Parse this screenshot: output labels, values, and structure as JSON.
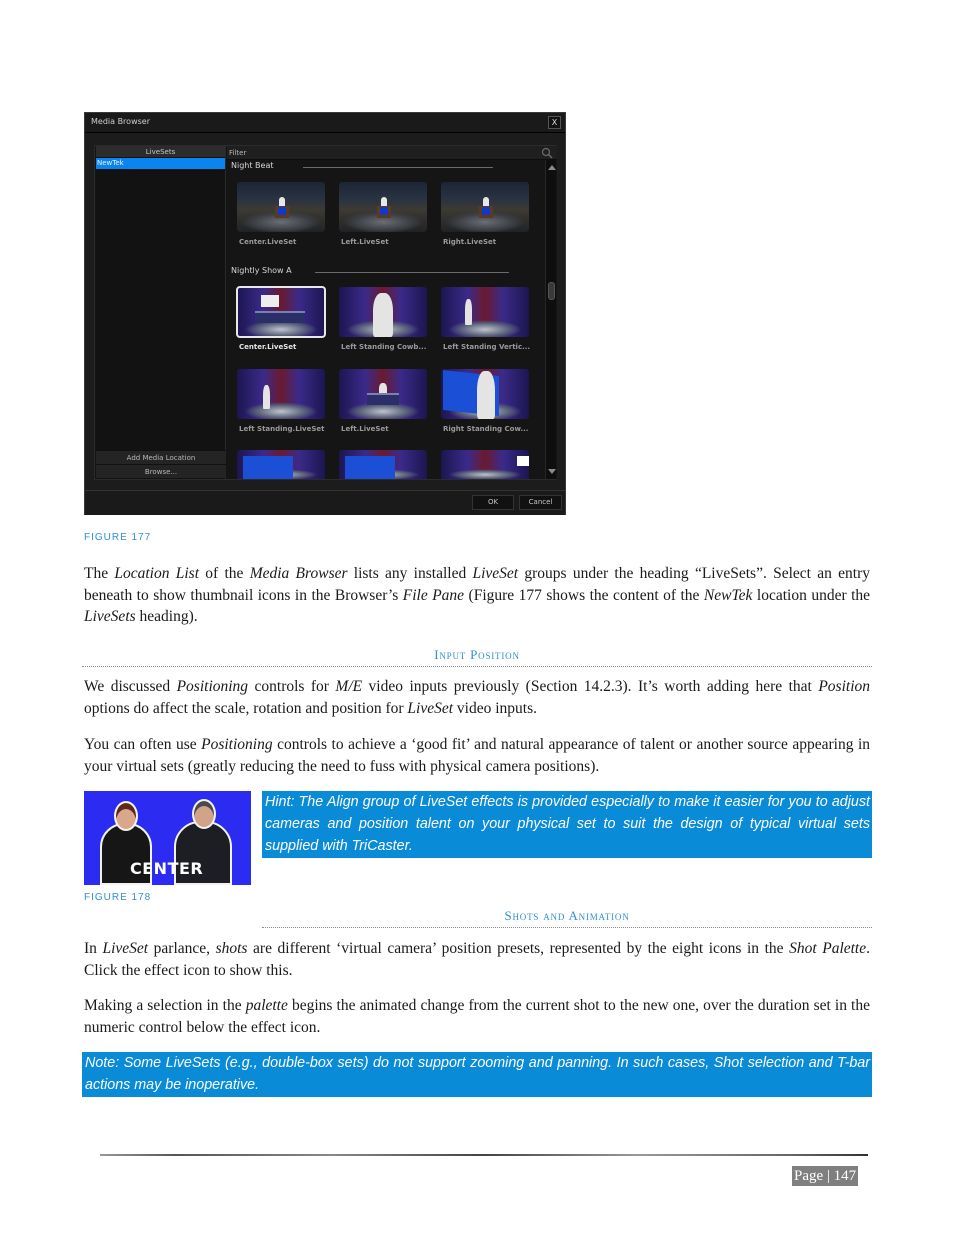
{
  "media_browser": {
    "title": "Media Browser",
    "close_label": "X",
    "location_list": {
      "header": "LiveSets",
      "items": [
        {
          "label": "NewTek",
          "selected": true
        }
      ],
      "add_button": "Add Media Location",
      "browse_button": "Browse..."
    },
    "file_pane": {
      "filter_label": "Filter",
      "groups": [
        {
          "title": "Night Beat",
          "items": [
            {
              "label": "Center.LiveSet"
            },
            {
              "label": "Left.LiveSet"
            },
            {
              "label": "Right.LiveSet"
            }
          ]
        },
        {
          "title": "Nightly Show A",
          "items": [
            {
              "label": "Center.LiveSet",
              "selected": true
            },
            {
              "label": "Left Standing Cowb..."
            },
            {
              "label": "Left Standing Vertic..."
            },
            {
              "label": "Left Standing.LiveSet"
            },
            {
              "label": "Left.LiveSet"
            },
            {
              "label": "Right Standing Cow..."
            }
          ]
        }
      ]
    },
    "ok_button": "OK",
    "cancel_button": "Cancel"
  },
  "figure_177_caption": "FIGURE 177",
  "para1": {
    "t1": "The ",
    "i1": "Location List",
    "t2": " of the ",
    "i2": "Media Browser",
    "t3": " lists any installed ",
    "i3": "LiveSet",
    "t4": " groups under the heading “LiveSets”.  Select an entry beneath to show thumbnail icons in the Browser’s ",
    "i4": "File Pane",
    "t5": " (Figure 177 shows the content of the ",
    "i5": "NewTek",
    "t6": " location under the ",
    "i6": "LiveSets",
    "t7": " heading)."
  },
  "section_input_position": "Input Position",
  "para2": {
    "t1": "We discussed ",
    "i1": "Positioning",
    "t2": " controls for ",
    "i2": "M/E",
    "t3": " video inputs previously (Section 14.2.3).  It’s worth adding here that ",
    "i3": "Position",
    "t4": " options do affect the scale, rotation and position for ",
    "i4": "LiveSet",
    "t5": " video inputs."
  },
  "para3": {
    "t1": "You can often use ",
    "i1": "Positioning",
    "t2": " controls to achieve a ‘good fit’ and natural appearance of talent or another source appearing in your virtual sets (greatly reducing the need to fuss with physical camera positions)."
  },
  "figure_178": {
    "overlay_label": "CENTER",
    "caption": "FIGURE 178"
  },
  "hint_text": "Hint: The Align group of LiveSet effects is provided especially to make it easier for you to adjust cameras and position talent on your physical set to suit the design of typical virtual sets supplied with TriCaster.",
  "section_shots": "Shots and Animation",
  "para4": {
    "t1": "In ",
    "i1": "LiveSet",
    "t2": " parlance, ",
    "i2": "shots",
    "t3": " are different ‘virtual camera’ position presets, represented by the eight icons in the ",
    "i3": "Shot Palette",
    "t4": ".  Click the effect icon to show this."
  },
  "para5": {
    "t1": "Making a selection in the ",
    "i1": "palette",
    "t2": " begins the animated change from the current shot to the new one, over the duration set in the numeric control below the effect icon."
  },
  "note_text": "Note: Some LiveSets (e.g., double-box sets) do not support zooming and panning.  In such cases, Shot selection and T-bar actions may be inoperative.",
  "page_number": "Page | 147",
  "colors": {
    "accent_blue": "#2e8fd4",
    "callout_bg": "#0a8bd8",
    "selection_blue": "#0a84f0",
    "page_badge": "#7f7f7f"
  }
}
